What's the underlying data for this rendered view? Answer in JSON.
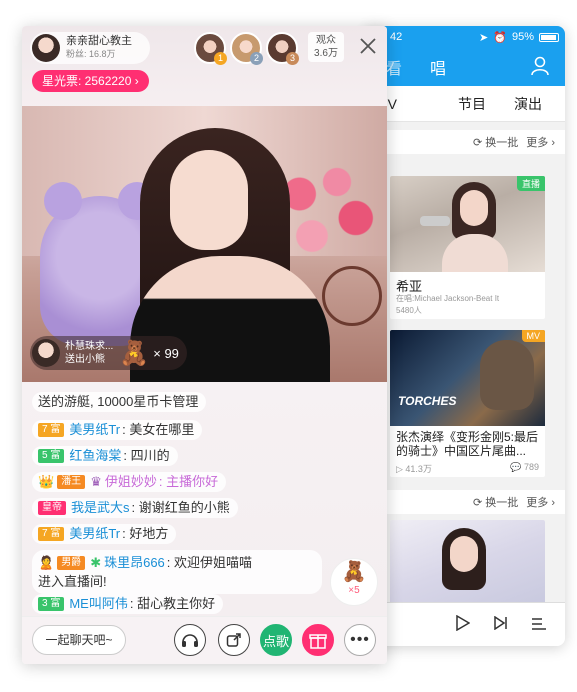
{
  "front": {
    "host": {
      "name": "亲亲甜心教主",
      "fans": "粉丝: 16.8万"
    },
    "ranks": [
      "1",
      "2",
      "3"
    ],
    "viewers": {
      "label": "观众",
      "count": "3.6万"
    },
    "star_ticket": "星光票: 2562220",
    "video_gift": {
      "sender": "朴慧珠求...",
      "action": "送出小熊",
      "count": "× 99"
    },
    "messages": [
      {
        "text": "送的游艇, 10000星币卡管理"
      },
      {
        "level": "7 富",
        "name": "美男纸Tr",
        "text": ": 美女在哪里"
      },
      {
        "level": "5 富",
        "name": "红鱼海棠",
        "text": ": 四川的"
      },
      {
        "level": "潘王",
        "name": "伊姐妙妙",
        "text": ": 主播你好"
      },
      {
        "level": "皇帝",
        "name": "我是武大s",
        "text": ": 谢谢红鱼的小熊"
      },
      {
        "level": "7 富",
        "name": "美男纸Tr",
        "text": ": 好地方"
      },
      {
        "level": "男爵",
        "name": "珠里昂666",
        "text": ": 欢迎伊姐喵喵",
        "text2": "进入直播间!"
      },
      {
        "level": "3 富",
        "name": "ME叫阿伟",
        "text": ": 甜心教主你好"
      }
    ],
    "gift_fab": {
      "icon": "🧸",
      "count": "×5"
    },
    "chat_placeholder": "一起聊天吧~",
    "song_btn": "点歌"
  },
  "back": {
    "status_time": "42",
    "battery": "95%",
    "top_left": "看",
    "top_tab": "唱",
    "tabs": [
      "MV",
      "节目",
      "演出"
    ],
    "refresh": "换一批",
    "more": "更多",
    "cards": [
      {
        "tag": "直播",
        "title": "希亚",
        "sub": "在唱:Michael Jackson-Beat It",
        "count": "5480人"
      },
      {
        "tag": "MV",
        "title": "张杰演绎《变形金刚5:最后的骑士》中国区片尾曲...",
        "plays": "41.3万",
        "comments": "789"
      }
    ],
    "colors": {
      "accent": "#1aa0ef",
      "live": "#39c46b",
      "mv": "#f5a623",
      "pink": "#ff2f72"
    }
  }
}
